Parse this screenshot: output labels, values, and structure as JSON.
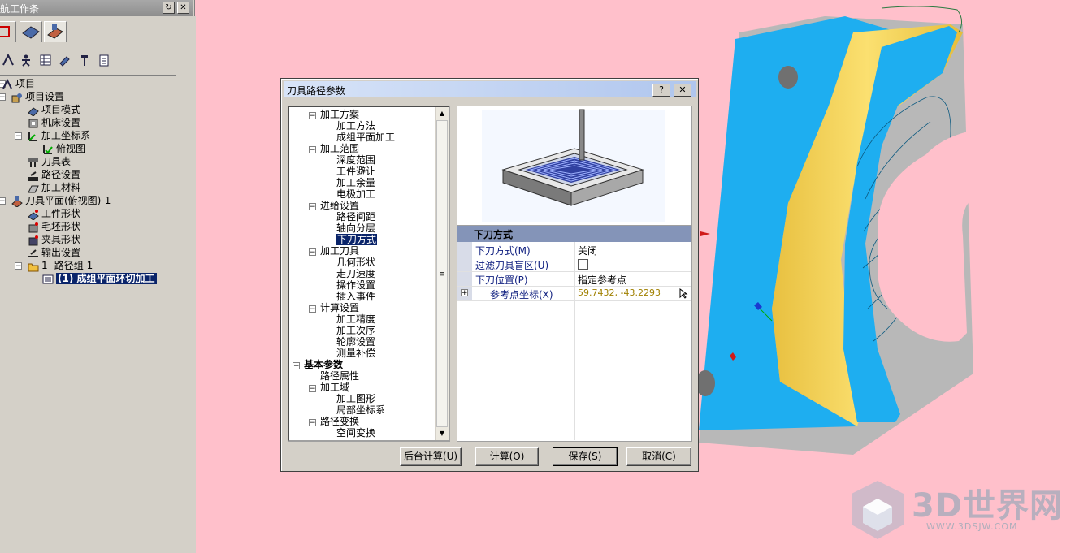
{
  "left_panel": {
    "title": "航工作条",
    "tree": [
      {
        "label": "项目"
      },
      {
        "label": "项目设置"
      },
      {
        "label": "项目模式"
      },
      {
        "label": "机床设置"
      },
      {
        "label": "加工坐标系"
      },
      {
        "label": "俯视图"
      },
      {
        "label": "刀具表"
      },
      {
        "label": "路径设置"
      },
      {
        "label": "加工材料"
      },
      {
        "label": "刀具平面(俯视图)-1"
      },
      {
        "label": "工件形状"
      },
      {
        "label": "毛坯形状"
      },
      {
        "label": "夹具形状"
      },
      {
        "label": "输出设置"
      },
      {
        "label": "1- 路径组 1"
      },
      {
        "label": "(1) 成组平面环切加工"
      }
    ]
  },
  "dialog": {
    "title": "刀具路径参数",
    "help_btn": "?",
    "close_btn": "✕",
    "tree": [
      {
        "label": "加工方案"
      },
      {
        "label": "加工方法"
      },
      {
        "label": "成组平面加工"
      },
      {
        "label": "加工范围"
      },
      {
        "label": "深度范围"
      },
      {
        "label": "工件避让"
      },
      {
        "label": "加工余量"
      },
      {
        "label": "电极加工"
      },
      {
        "label": "进给设置"
      },
      {
        "label": "路径间距"
      },
      {
        "label": "轴向分层"
      },
      {
        "label": "下刀方式"
      },
      {
        "label": "加工刀具"
      },
      {
        "label": "几何形状"
      },
      {
        "label": "走刀速度"
      },
      {
        "label": "操作设置"
      },
      {
        "label": "插入事件"
      },
      {
        "label": "计算设置"
      },
      {
        "label": "加工精度"
      },
      {
        "label": "加工次序"
      },
      {
        "label": "轮廓设置"
      },
      {
        "label": "测量补偿"
      },
      {
        "label": "基本参数"
      },
      {
        "label": "路径属性"
      },
      {
        "label": "加工域"
      },
      {
        "label": "加工图形"
      },
      {
        "label": "局部坐标系"
      },
      {
        "label": "路径变换"
      },
      {
        "label": "空间变换"
      }
    ],
    "props": {
      "header": "下刀方式",
      "rows": [
        {
          "key": "下刀方式(M)",
          "value": "关闭"
        },
        {
          "key": "过滤刀具盲区(U)",
          "value": ""
        },
        {
          "key": "下刀位置(P)",
          "value": "指定参考点"
        },
        {
          "key": "参考点坐标(X)",
          "value": "59.7432, -43.2293"
        }
      ]
    },
    "buttons": {
      "background": "后台计算(U)",
      "compute": "计算(O)",
      "save": "保存(S)",
      "cancel": "取消(C)"
    }
  },
  "watermark": {
    "brand": "3D世界网",
    "url": "WWW.3DSJW.COM"
  },
  "colors": {
    "background": "#ffc0cb",
    "selection": "#0a246a",
    "props_header": "#8494b8",
    "part_blue": "#1eaef0",
    "part_yellow": "#f5d248"
  }
}
